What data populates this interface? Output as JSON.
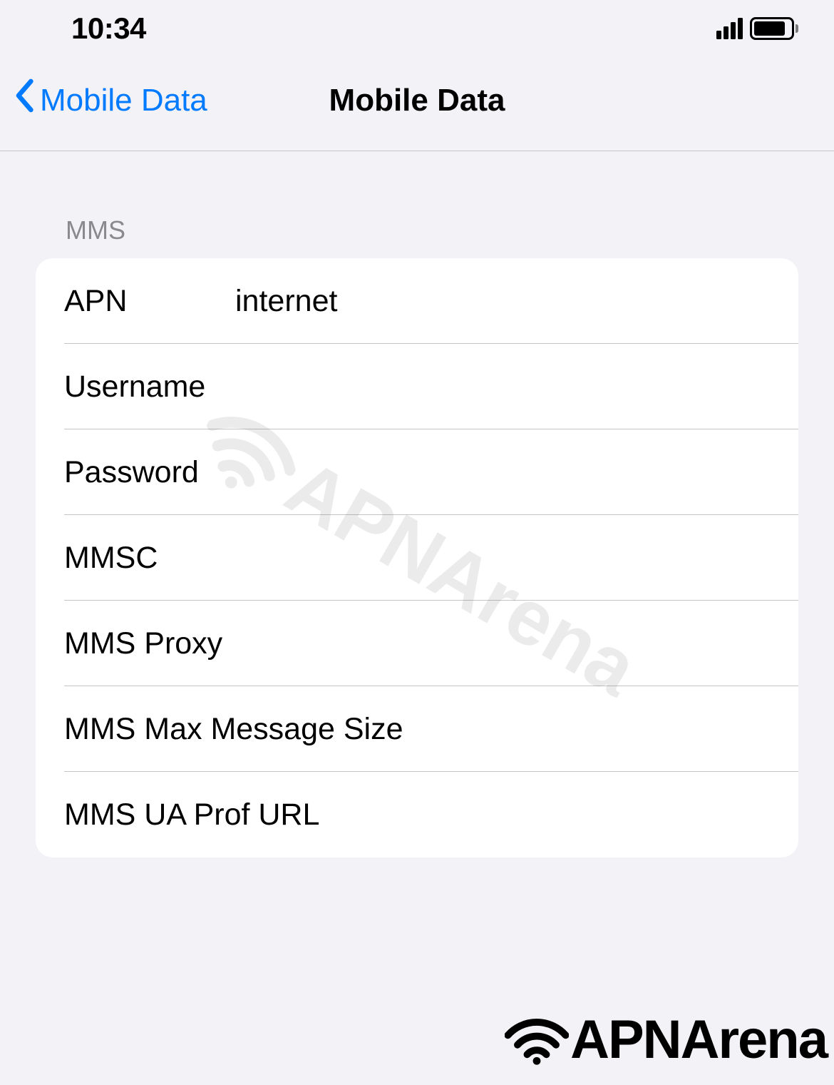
{
  "status_bar": {
    "time": "10:34"
  },
  "nav": {
    "back_label": "Mobile Data",
    "title": "Mobile Data"
  },
  "section_header": "MMS",
  "fields": [
    {
      "label": "APN",
      "value": "internet"
    },
    {
      "label": "Username",
      "value": ""
    },
    {
      "label": "Password",
      "value": ""
    },
    {
      "label": "MMSC",
      "value": ""
    },
    {
      "label": "MMS Proxy",
      "value": ""
    },
    {
      "label": "MMS Max Message Size",
      "value": ""
    },
    {
      "label": "MMS UA Prof URL",
      "value": ""
    }
  ],
  "watermark": "APNArena"
}
